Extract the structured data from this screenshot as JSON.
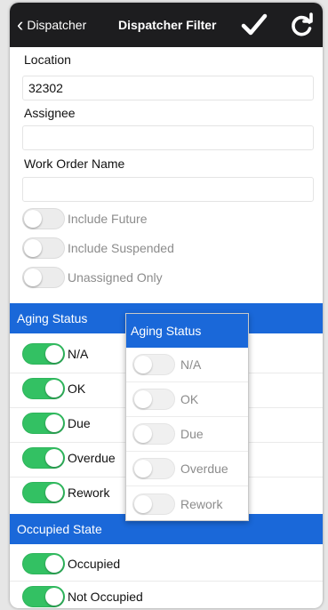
{
  "nav": {
    "back_label": "Dispatcher",
    "title": "Dispatcher Filter"
  },
  "form": {
    "location_label": "Location",
    "location_value": "32302",
    "assignee_label": "Assignee",
    "assignee_value": "",
    "work_order_label": "Work Order Name",
    "work_order_value": ""
  },
  "options": [
    {
      "label": "Include Future",
      "on": false
    },
    {
      "label": "Include Suspended",
      "on": false
    },
    {
      "label": "Unassigned Only",
      "on": false
    }
  ],
  "aging": {
    "header": "Aging Status",
    "items": [
      {
        "label": "N/A",
        "on": true
      },
      {
        "label": "OK",
        "on": true
      },
      {
        "label": "Due",
        "on": true
      },
      {
        "label": "Overdue",
        "on": true
      },
      {
        "label": "Rework",
        "on": true
      }
    ]
  },
  "occupied": {
    "header": "Occupied State",
    "items": [
      {
        "label": "Occupied",
        "on": true
      },
      {
        "label": "Not Occupied",
        "on": true
      }
    ]
  },
  "popup": {
    "title": "Aging Status",
    "items": [
      {
        "label": "N/A",
        "on": false
      },
      {
        "label": "OK",
        "on": false
      },
      {
        "label": "Due",
        "on": false
      },
      {
        "label": "Overdue",
        "on": false
      },
      {
        "label": "Rework",
        "on": false
      }
    ]
  },
  "colors": {
    "accent": "#1a68d9",
    "toggle_on": "#33c163",
    "navbar": "#1d1d1f"
  }
}
